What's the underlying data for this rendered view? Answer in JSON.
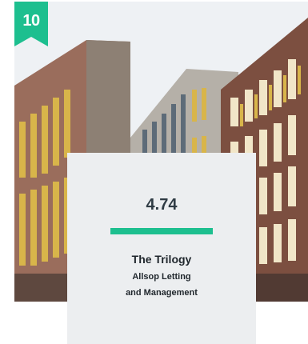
{
  "listing": {
    "rank": "10",
    "score": "4.74",
    "name": "The Trilogy",
    "operator_line1": "Allsop Letting",
    "operator_line2": "and Management"
  },
  "colors": {
    "accent": "#1dbf8f",
    "panel": "#eceef0",
    "text": "#2f3b44"
  }
}
